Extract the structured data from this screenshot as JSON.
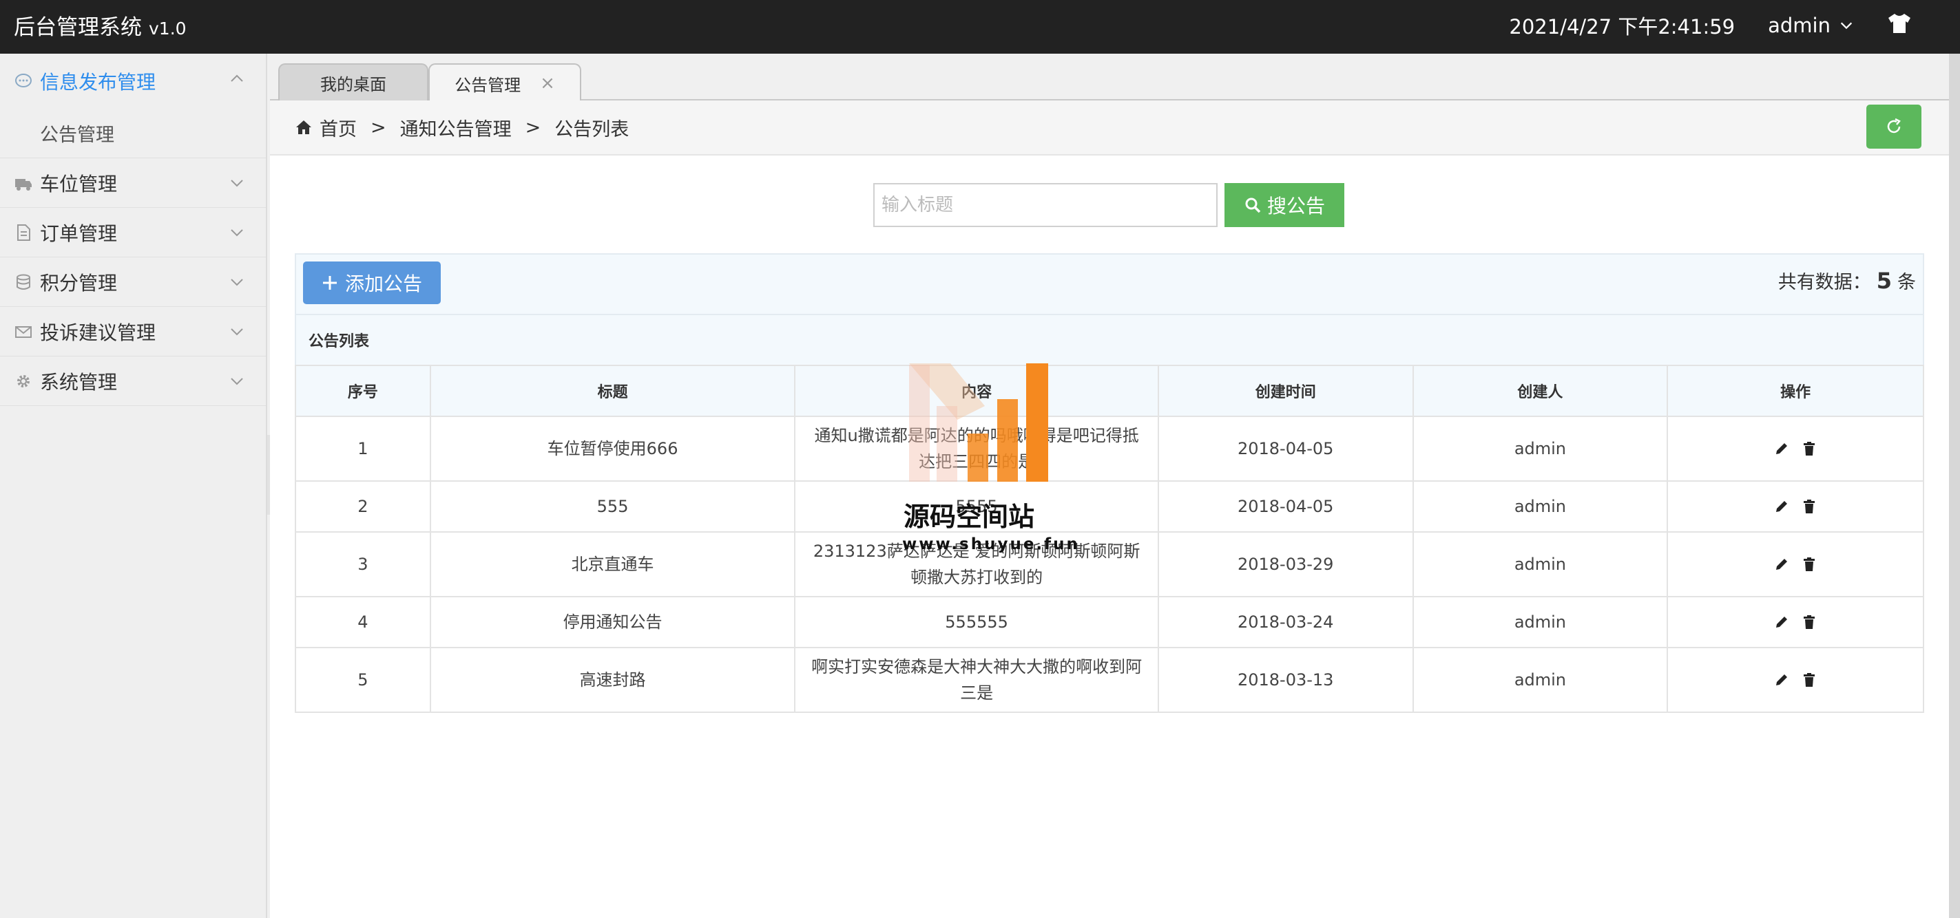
{
  "header": {
    "app_title": "后台管理系统",
    "version": "v1.0",
    "datetime": "2021/4/27 下午2:41:59",
    "username": "admin"
  },
  "sidebar": {
    "items": [
      {
        "label": "信息发布管理",
        "icon": "chat-icon",
        "expanded": true,
        "children": [
          {
            "label": "公告管理"
          }
        ]
      },
      {
        "label": "车位管理",
        "icon": "truck-icon"
      },
      {
        "label": "订单管理",
        "icon": "document-icon"
      },
      {
        "label": "积分管理",
        "icon": "database-icon"
      },
      {
        "label": "投诉建议管理",
        "icon": "envelope-icon"
      },
      {
        "label": "系统管理",
        "icon": "gear-icon"
      }
    ]
  },
  "tabs": [
    {
      "label": "我的桌面",
      "active": false
    },
    {
      "label": "公告管理",
      "active": true,
      "close": "×"
    }
  ],
  "breadcrumb": {
    "items": [
      "首页",
      "通知公告管理",
      "公告列表"
    ],
    "separator": ">"
  },
  "search": {
    "placeholder": "输入标题",
    "value": "",
    "button_label": "搜公告"
  },
  "toolbar": {
    "add_label": "添加公告",
    "total_prefix": "共有数据：",
    "total_count": "5",
    "total_suffix": "条"
  },
  "table": {
    "caption": "公告列表",
    "columns": [
      "序号",
      "标题",
      "内容",
      "创建时间",
      "创建人",
      "操作"
    ],
    "rows": [
      {
        "id": "1",
        "title": "车位暂停使用666",
        "content": "通知u撒谎都是阿达的的吗哦哦得是吧记得抵达把三四四的是",
        "time": "2018-04-05",
        "user": "admin"
      },
      {
        "id": "2",
        "title": "555",
        "content": "5555",
        "time": "2018-04-05",
        "user": "admin"
      },
      {
        "id": "3",
        "title": "北京直通车",
        "content": "2313123萨达萨达是 爱的阿斯顿阿斯顿阿斯顿撒大苏打收到的",
        "time": "2018-03-29",
        "user": "admin"
      },
      {
        "id": "4",
        "title": "停用通知公告",
        "content": "555555",
        "time": "2018-03-24",
        "user": "admin"
      },
      {
        "id": "5",
        "title": "高速封路",
        "content": "啊实打实安德森是大神大神大大撒的啊收到阿三是",
        "time": "2018-03-13",
        "user": "admin"
      }
    ]
  },
  "watermark": {
    "name": "源码空间站",
    "url": "www.shuyue.fun"
  },
  "colors": {
    "header_bg": "#222222",
    "accent_blue": "#2e8ded",
    "success_green": "#5cb85c",
    "primary_btn": "#5a98de",
    "watermark_orange": "#f5891f"
  }
}
